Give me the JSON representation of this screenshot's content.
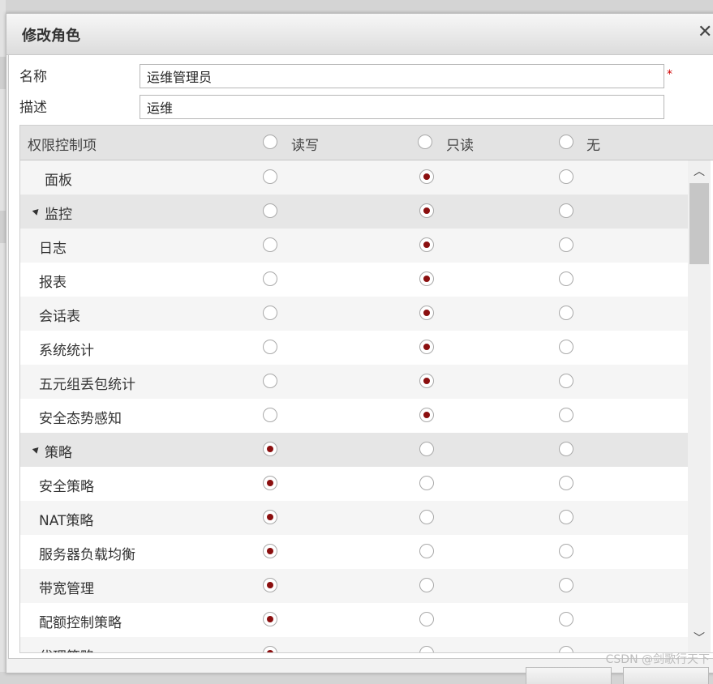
{
  "dialog": {
    "title": "修改角色",
    "close_icon": "close-icon"
  },
  "form": {
    "name_label": "名称",
    "name_value": "运维管理员",
    "required_mark": "*",
    "desc_label": "描述",
    "desc_value": "运维"
  },
  "table": {
    "header": {
      "item_label": "权限控制项",
      "read_write": "读写",
      "read_only": "只读",
      "none": "无"
    },
    "rows": [
      {
        "label": "面板",
        "group": false,
        "value": "read_only"
      },
      {
        "label": "监控",
        "group": true,
        "value": "read_only"
      },
      {
        "label": "日志",
        "group": false,
        "value": "read_only"
      },
      {
        "label": "报表",
        "group": false,
        "value": "read_only"
      },
      {
        "label": "会话表",
        "group": false,
        "value": "read_only"
      },
      {
        "label": "系统统计",
        "group": false,
        "value": "read_only"
      },
      {
        "label": "五元组丢包统计",
        "group": false,
        "value": "read_only"
      },
      {
        "label": "安全态势感知",
        "group": false,
        "value": "read_only"
      },
      {
        "label": "策略",
        "group": true,
        "value": "read_write"
      },
      {
        "label": "安全策略",
        "group": false,
        "value": "read_write"
      },
      {
        "label": "NAT策略",
        "group": false,
        "value": "read_write"
      },
      {
        "label": "服务器负载均衡",
        "group": false,
        "value": "read_write"
      },
      {
        "label": "带宽管理",
        "group": false,
        "value": "read_write"
      },
      {
        "label": "配额控制策略",
        "group": false,
        "value": "read_write"
      },
      {
        "label": "代理策略",
        "group": false,
        "value": "read_write"
      }
    ]
  },
  "watermark": "CSDN @剑歌行天下",
  "colors": {
    "radio_checked": "#8b0f0f",
    "required": "#d00000",
    "header_bg": "#e3e3e3"
  }
}
